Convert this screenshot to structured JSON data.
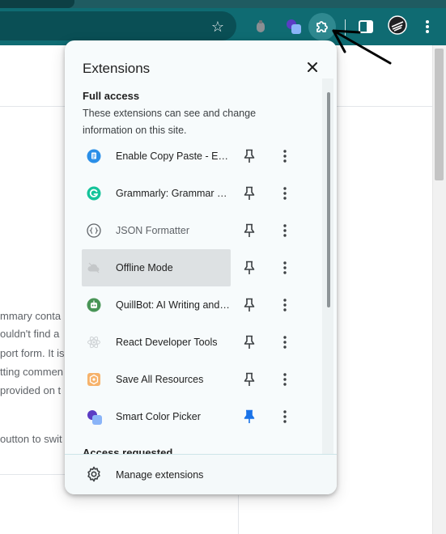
{
  "browser": {
    "toolbar_icons": [
      "star-icon",
      "extension-grey-icon",
      "smart-color-picker-icon",
      "puzzle-icon",
      "side-panel-icon",
      "avatar",
      "menu-icon"
    ],
    "colors": {
      "toolbar": "#0f6b72",
      "tabstrip": "#1f5b61",
      "omnibox": "#0a4f55"
    }
  },
  "background_page": {
    "text_fragments": [
      "mmary conta",
      "ouldn't find a",
      "port form. It is",
      "tting commen",
      "provided on t",
      "outton to swit"
    ]
  },
  "popup": {
    "title": "Extensions",
    "section_full_access": {
      "heading": "Full access",
      "description": "These extensions can see and change information on this site."
    },
    "extensions": [
      {
        "name": "Enable Copy Paste - E.C.P",
        "icon": "copy-paste-icon",
        "pinned": false,
        "highlighted": false,
        "dim": false
      },
      {
        "name": "Grammarly: Grammar Checker and Writing App",
        "icon": "grammarly-icon",
        "pinned": false,
        "highlighted": false,
        "dim": false
      },
      {
        "name": "JSON Formatter",
        "icon": "json-formatter-icon",
        "pinned": false,
        "highlighted": false,
        "dim": true
      },
      {
        "name": "Offline Mode",
        "icon": "offline-mode-icon",
        "pinned": false,
        "highlighted": true,
        "dim": false
      },
      {
        "name": "QuillBot: AI Writing and Grammar Checker Tool",
        "icon": "quillbot-icon",
        "pinned": false,
        "highlighted": false,
        "dim": false
      },
      {
        "name": "React Developer Tools",
        "icon": "react-devtools-icon",
        "pinned": false,
        "highlighted": false,
        "dim": false
      },
      {
        "name": "Save All Resources",
        "icon": "save-all-resources-icon",
        "pinned": false,
        "highlighted": false,
        "dim": false
      },
      {
        "name": "Smart Color Picker",
        "icon": "smart-color-picker-icon",
        "pinned": true,
        "highlighted": false,
        "dim": false
      }
    ],
    "next_section_heading": "Access requested",
    "footer": {
      "label": "Manage extensions",
      "icon": "gear-icon"
    },
    "colors": {
      "background": "#f7fbfc",
      "highlight": "#dde1e3",
      "pinned": "#1a73e8"
    }
  }
}
